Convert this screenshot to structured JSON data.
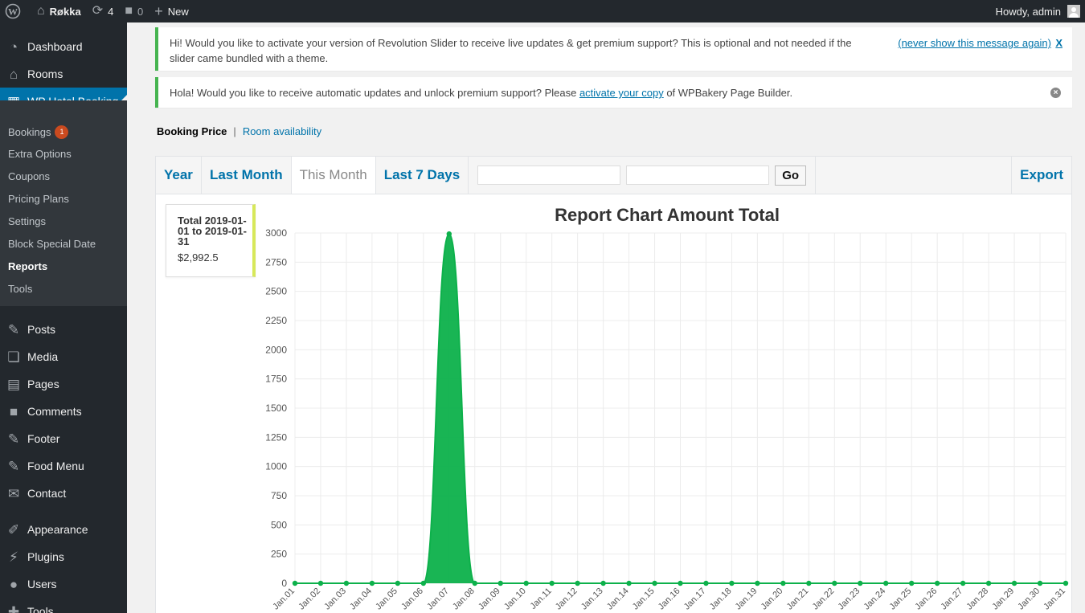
{
  "admin_bar": {
    "site_name": "Røkka",
    "updates_count": "4",
    "comments_count": "0",
    "new_label": "New",
    "howdy": "Howdy, admin"
  },
  "sidebar": {
    "top_items": [
      {
        "label": "Dashboard",
        "icon": "dashboard-icon"
      },
      {
        "label": "Rooms",
        "icon": "home-icon"
      },
      {
        "label": "WP Hotel Booking",
        "icon": "calendar-icon"
      }
    ],
    "submenu": [
      {
        "label": "Bookings",
        "badge": "1"
      },
      {
        "label": "Extra Options"
      },
      {
        "label": "Coupons"
      },
      {
        "label": "Pricing Plans"
      },
      {
        "label": "Settings"
      },
      {
        "label": "Block Special Date"
      },
      {
        "label": "Reports"
      },
      {
        "label": "Tools"
      }
    ],
    "bottom_items": [
      {
        "label": "Posts",
        "icon": "pin-icon"
      },
      {
        "label": "Media",
        "icon": "media-icon"
      },
      {
        "label": "Pages",
        "icon": "pages-icon"
      },
      {
        "label": "Comments",
        "icon": "comment-icon"
      },
      {
        "label": "Footer",
        "icon": "pin-icon"
      },
      {
        "label": "Food Menu",
        "icon": "pin-icon"
      },
      {
        "label": "Contact",
        "icon": "mail-icon"
      },
      {
        "label": "Appearance",
        "icon": "brush-icon"
      },
      {
        "label": "Plugins",
        "icon": "plug-icon"
      },
      {
        "label": "Users",
        "icon": "user-icon"
      },
      {
        "label": "Tools",
        "icon": "wrench-icon"
      }
    ]
  },
  "notices": {
    "revslider": {
      "text_line1": "Hi! Would you like to activate your version of Revolution Slider to receive live updates & get premium support? This is optional and not needed if the",
      "text_line2": "slider came bundled with a theme.",
      "never_link": "(never show this message again)",
      "dismiss": "X"
    },
    "wpbakery": {
      "text_before": "Hola! Would you like to receive automatic updates and unlock premium support? Please ",
      "link": "activate your copy",
      "text_after": " of WPBakery Page Builder."
    }
  },
  "report_nav": {
    "current": "Booking Price",
    "separator": "|",
    "other": "Room availability"
  },
  "tabs": {
    "year": "Year",
    "last_month": "Last Month",
    "this_month": "This Month",
    "last_7_days": "Last 7 Days",
    "go": "Go",
    "export": "Export",
    "from_value": "",
    "to_value": ""
  },
  "totals": {
    "label": "Total 2019-01-01 to 2019-01-31",
    "value": "$2,992.5"
  },
  "colors": {
    "accent": "#0073aa",
    "series": "#0db14b",
    "sidebar_bg": "#23282d",
    "notice_border": "#46b450"
  },
  "chart_data": {
    "type": "area",
    "title": "Report Chart Amount Total",
    "xlabel": "",
    "ylabel": "",
    "ylim": [
      0,
      3000
    ],
    "yticks": [
      0,
      250,
      500,
      750,
      1000,
      1250,
      1500,
      1750,
      2000,
      2250,
      2500,
      2750,
      3000
    ],
    "grid": true,
    "categories": [
      "Jan.01",
      "Jan.02",
      "Jan.03",
      "Jan.04",
      "Jan.05",
      "Jan.06",
      "Jan.07",
      "Jan.08",
      "Jan.09",
      "Jan.10",
      "Jan.11",
      "Jan.12",
      "Jan.13",
      "Jan.14",
      "Jan.15",
      "Jan.16",
      "Jan.17",
      "Jan.18",
      "Jan.19",
      "Jan.20",
      "Jan.21",
      "Jan.22",
      "Jan.23",
      "Jan.24",
      "Jan.25",
      "Jan.26",
      "Jan.27",
      "Jan.28",
      "Jan.29",
      "Jan.30",
      "Jan.31"
    ],
    "series": [
      {
        "values": [
          0,
          0,
          0,
          0,
          0,
          0,
          2992.5,
          0,
          0,
          0,
          0,
          0,
          0,
          0,
          0,
          0,
          0,
          0,
          0,
          0,
          0,
          0,
          0,
          0,
          0,
          0,
          0,
          0,
          0,
          0,
          0
        ]
      }
    ]
  }
}
